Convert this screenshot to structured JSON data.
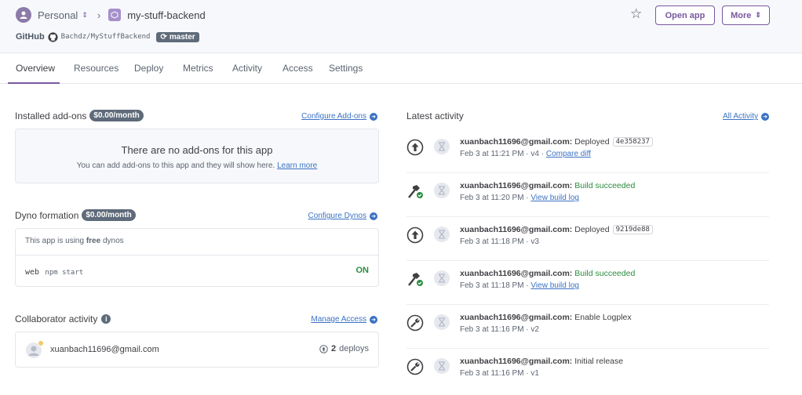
{
  "header": {
    "team": "Personal",
    "app_name": "my-stuff-backend",
    "github_label": "GitHub",
    "repo": "Bachdz/MyStuffBackend",
    "branch": "master",
    "open_app": "Open app",
    "more": "More"
  },
  "tabs": [
    "Overview",
    "Resources",
    "Deploy",
    "Metrics",
    "Activity",
    "Access",
    "Settings"
  ],
  "addons": {
    "title": "Installed add-ons",
    "price": "$0.00/month",
    "configure": "Configure Add-ons",
    "empty_title": "There are no add-ons for this app",
    "empty_sub": "You can add add-ons to this app and they will show here.",
    "learn_more": "Learn more"
  },
  "dyno": {
    "title": "Dyno formation",
    "price": "$0.00/month",
    "configure": "Configure Dynos",
    "note_pre": "This app is using ",
    "note_bold": "free",
    "note_post": " dynos",
    "type": "web",
    "command": "npm start",
    "status": "ON"
  },
  "collab": {
    "title": "Collaborator activity",
    "manage": "Manage Access",
    "email": "xuanbach11696@gmail.com",
    "deploy_count": "2",
    "deploy_label": "deploys"
  },
  "activity": {
    "title": "Latest activity",
    "all": "All Activity",
    "items": [
      {
        "user": "xuanbach11696@gmail.com:",
        "action": "Deployed",
        "sha": "4e358237",
        "meta": "Feb 3 at 11:21 PM · v4 · ",
        "link": "Compare diff",
        "kind": "deploy"
      },
      {
        "user": "xuanbach11696@gmail.com:",
        "action": "Build succeeded",
        "sha": "",
        "meta": "Feb 3 at 11:20 PM · ",
        "link": "View build log",
        "kind": "build"
      },
      {
        "user": "xuanbach11696@gmail.com:",
        "action": "Deployed",
        "sha": "9219de88",
        "meta": "Feb 3 at 11:18 PM · v3",
        "link": "",
        "kind": "deploy"
      },
      {
        "user": "xuanbach11696@gmail.com:",
        "action": "Build succeeded",
        "sha": "",
        "meta": "Feb 3 at 11:18 PM · ",
        "link": "View build log",
        "kind": "build"
      },
      {
        "user": "xuanbach11696@gmail.com:",
        "action": "Enable Logplex",
        "sha": "",
        "meta": "Feb 3 at 11:16 PM · v2",
        "link": "",
        "kind": "config"
      },
      {
        "user": "xuanbach11696@gmail.com:",
        "action": "Initial release",
        "sha": "",
        "meta": "Feb 3 at 11:16 PM · v1",
        "link": "",
        "kind": "config"
      }
    ]
  }
}
